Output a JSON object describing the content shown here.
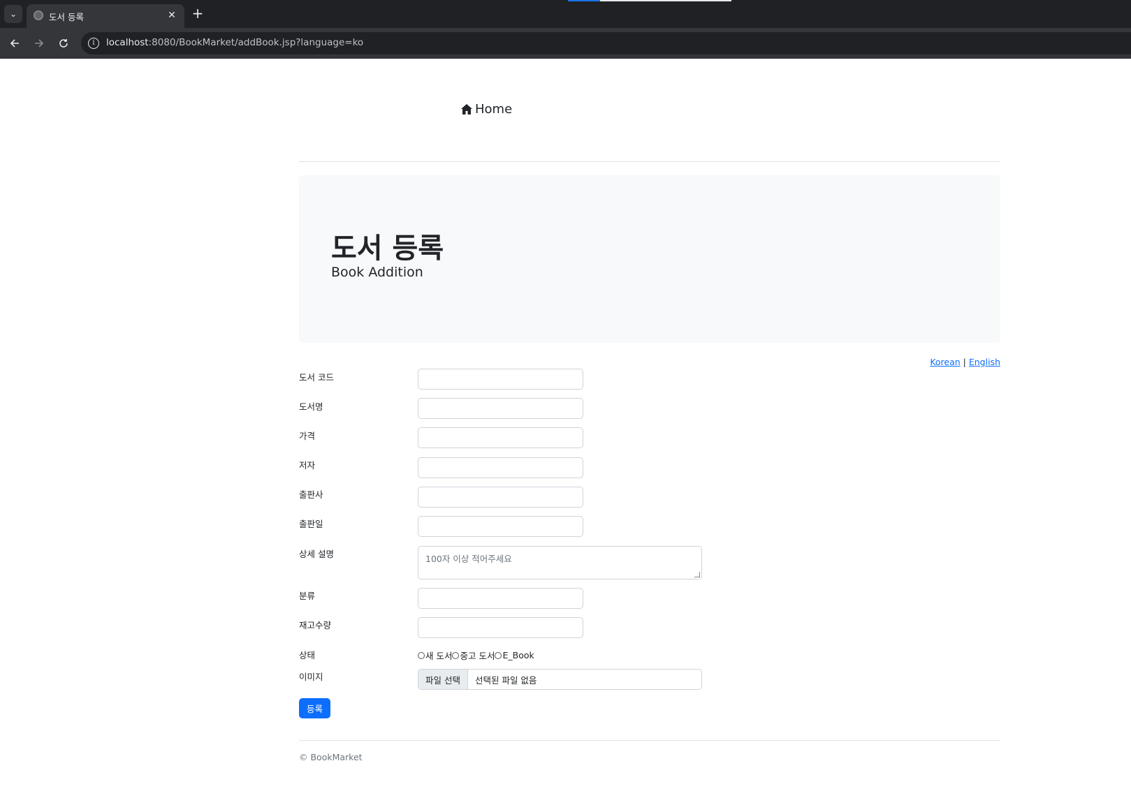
{
  "browser": {
    "tab_title": "도서 등록",
    "new_tab_label": "+",
    "close_label": "✕",
    "url_host": "localhost",
    "url_rest": ":8080/BookMarket/addBook.jsp?language=ko"
  },
  "nav": {
    "home_label": "Home"
  },
  "jumbotron": {
    "title": "도서 등록",
    "subtitle": "Book Addition"
  },
  "language": {
    "korean": "Korean",
    "separator": "|",
    "english": "English"
  },
  "form": {
    "fields": [
      {
        "label": "도서 코드",
        "value": ""
      },
      {
        "label": "도서명",
        "value": ""
      },
      {
        "label": "가격",
        "value": ""
      },
      {
        "label": "저자",
        "value": ""
      },
      {
        "label": "출판사",
        "value": ""
      },
      {
        "label": "출판일",
        "value": ""
      }
    ],
    "description": {
      "label": "상세 설명",
      "placeholder": "100자 이상 적어주세요"
    },
    "category": {
      "label": "분류",
      "value": ""
    },
    "stock": {
      "label": "재고수량",
      "value": ""
    },
    "condition": {
      "label": "상태",
      "options": [
        "새 도서",
        "중고 도서",
        "E_Book"
      ]
    },
    "image": {
      "label": "이미지",
      "button_label": "파일 선택",
      "status": "선택된 파일 없음"
    },
    "submit_label": "등록"
  },
  "footer": {
    "text": "© BookMarket"
  },
  "colors": {
    "primary": "#0d6efd",
    "jumbotron_bg": "#f8f9fa",
    "browser_dark": "#202124",
    "browser_toolbar": "#35363a"
  }
}
